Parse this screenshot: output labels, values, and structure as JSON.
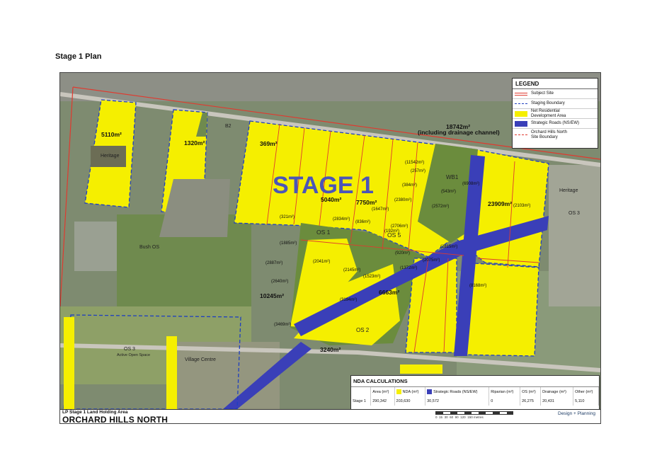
{
  "page_title": "Stage 1 Plan",
  "map": {
    "stage_label": "STAGE 1",
    "area_labels": [
      "5110m²",
      "1320m²",
      "369m²",
      "18742m²",
      "(including drainage channel)",
      "5040m²",
      "7750m²",
      "23909m²",
      "10245m²",
      "6663m²",
      "3240m²"
    ],
    "small_labels": [
      "(11542m²)",
      "(257m²)",
      "(384m²)",
      "(543m²)",
      "(6908m²)",
      "(2380m²)",
      "(1647m²)",
      "(2572m²)",
      "(2103m²)",
      "(321m²)",
      "(2834m²)",
      "(836m²)",
      "(2706m²)",
      "(192m²)",
      "(1885m²)",
      "(920m²)",
      "(2815m²)",
      "(2887m²)",
      "(2041m²)",
      "(2145m²)",
      "(1372m²)",
      "(2075m²)",
      "(1523m²)",
      "(2640m²)",
      "(8168m²)",
      "(3194m²)",
      "(3469m²)"
    ],
    "place_labels": [
      "Heritage",
      "B2",
      "WB1",
      "Heritage",
      "OS 3",
      "OS 1",
      "OS 5",
      "Bush OS",
      "OS 2",
      "OS 3",
      "Active Open Space",
      "Village Centre"
    ]
  },
  "legend": {
    "title": "LEGEND",
    "items": [
      {
        "label": "Subject Site",
        "color": "#e03a2f"
      },
      {
        "label": "Staging Boundary",
        "color": "#1f3fbf"
      },
      {
        "label": "Net Residential\nDevelopment Area",
        "color": "#f5ef00"
      },
      {
        "label": "Strategic Roads (NS/EW)",
        "color": "#3a3fb8"
      },
      {
        "label": "Orchard Hills North\nSite Boundary",
        "color": "#e03a2f"
      }
    ]
  },
  "nda_calculations": {
    "title": "NDA CALCULATIONS",
    "headers": [
      "",
      "Area (m²)",
      "NDA (m²)",
      "Strategic Roads (NS/EW)",
      "Riparian (m²)",
      "OS (m²)",
      "Drainage (m²)",
      "Other (m²)"
    ],
    "row": [
      "Stage 1",
      "290,342",
      "203,630",
      "30,572",
      "0",
      "26,275",
      "20,431",
      "5,110"
    ],
    "colors": {
      "nda": "#f5ef00",
      "roads": "#3a3fb8"
    }
  },
  "title_block": {
    "subtitle": "LP Stage 1 Land Holding Area",
    "title": "ORCHARD HILLS NORTH",
    "scale_ticks": [
      "0",
      "15",
      "30",
      "60",
      "90",
      "120",
      "150 metres"
    ],
    "logo_text": "Design + Planning"
  }
}
